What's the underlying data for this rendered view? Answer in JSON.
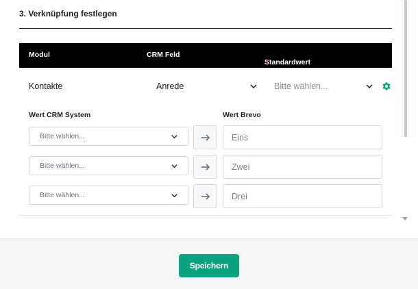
{
  "section": {
    "title": "3. Verknüpfung festlegen"
  },
  "table": {
    "headers": {
      "modul": "Modul",
      "crm": "CRM Feld",
      "standard": "Standardwert",
      "required_mark": "*"
    },
    "row": {
      "modul": "Kontakte",
      "crm_field": "Anrede",
      "standard_placeholder": "Bitte wählen..."
    }
  },
  "mapping": {
    "left_label": "Wert CRM System",
    "right_label": "Wert Brevo",
    "rows": [
      {
        "crm_placeholder": "Bitte wählen...",
        "brevo_value": "Eins"
      },
      {
        "crm_placeholder": "Bitte wählen...",
        "brevo_value": "Zwei"
      },
      {
        "crm_placeholder": "Bitte wählen...",
        "brevo_value": "Drei"
      }
    ]
  },
  "footer": {
    "save_label": "Speichern"
  },
  "colors": {
    "accent": "#0ba37f",
    "header_bg": "#000000",
    "required": "#e53935"
  },
  "icons": {
    "dropdown": "chevron-down-icon",
    "settings": "gear-icon",
    "map": "arrow-right-icon"
  }
}
